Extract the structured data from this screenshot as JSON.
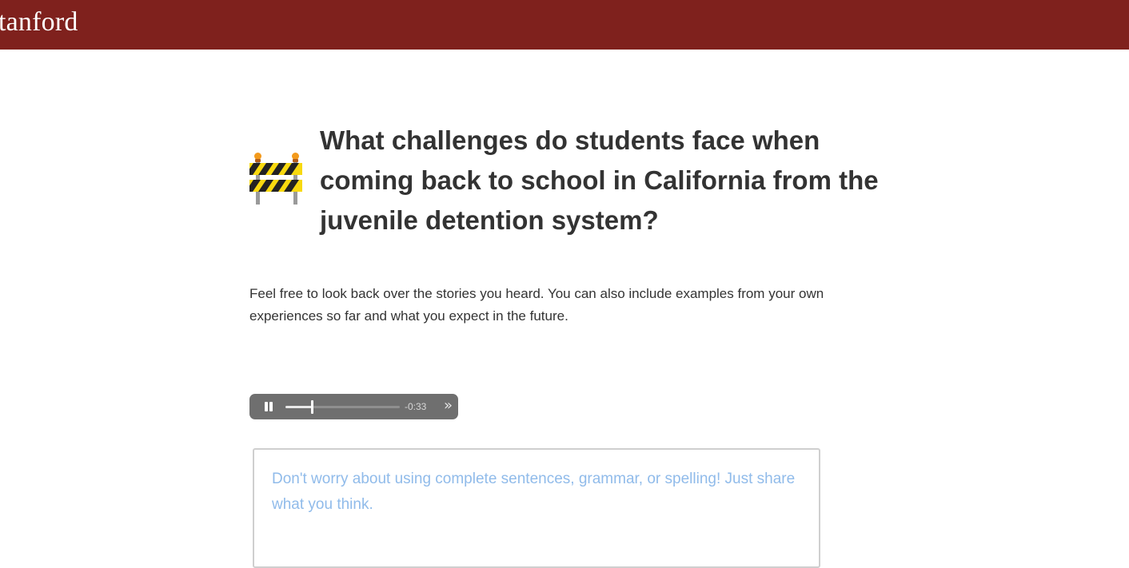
{
  "header": {
    "brand_text": "tanford",
    "background_color": "#7f211d"
  },
  "question": {
    "icon": "construction-barrier-icon",
    "title": "What challenges do students face when coming back to school in California from the juvenile detention system?"
  },
  "instructions": {
    "text": "Feel free to look back over the stories you heard. You can also include examples from your own experiences so far and what you expect in the future."
  },
  "audio": {
    "state": "playing",
    "pause_icon": "pause-icon",
    "remaining_time": "-0:33",
    "progress_fraction": 0.23,
    "skip_icon": "fast-forward-icon",
    "skip_glyph": "»"
  },
  "response": {
    "value": "",
    "placeholder": "Don't worry about using complete sentences, grammar, or spelling! Just share what you think."
  },
  "colors": {
    "title": "#333333",
    "placeholder": "#90bbea",
    "player_background": "#6f6f6f"
  }
}
